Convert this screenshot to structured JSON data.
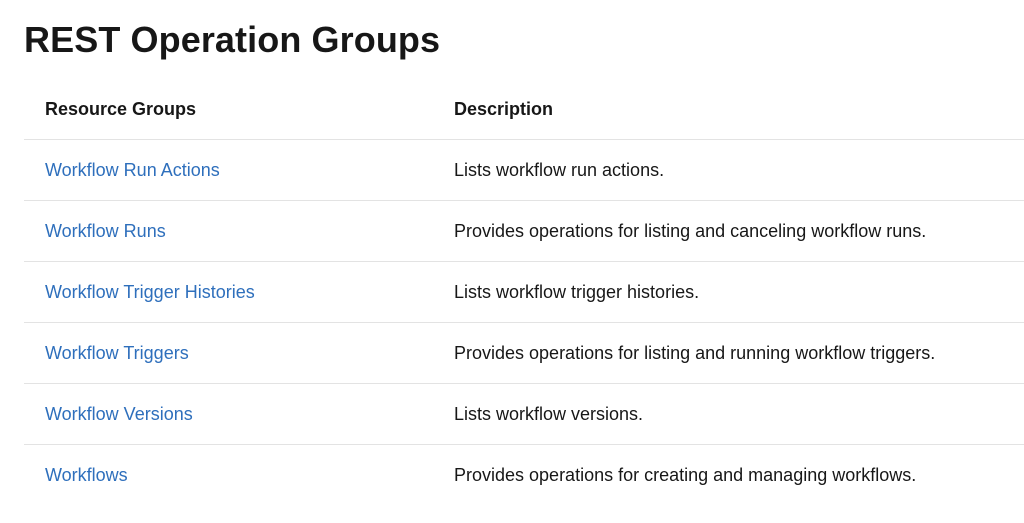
{
  "page": {
    "title": "REST Operation Groups"
  },
  "table": {
    "headers": {
      "resource_groups": "Resource Groups",
      "description": "Description"
    },
    "rows": [
      {
        "name": "Workflow Run Actions",
        "description": "Lists workflow run actions."
      },
      {
        "name": "Workflow Runs",
        "description": "Provides operations for listing and canceling workflow runs."
      },
      {
        "name": "Workflow Trigger Histories",
        "description": "Lists workflow trigger histories."
      },
      {
        "name": "Workflow Triggers",
        "description": "Provides operations for listing and running workflow triggers."
      },
      {
        "name": "Workflow Versions",
        "description": "Lists workflow versions."
      },
      {
        "name": "Workflows",
        "description": "Provides operations for creating and managing workflows."
      }
    ]
  },
  "colors": {
    "link": "#2e6fbc",
    "text": "#171717",
    "divider": "#e3e3e3"
  }
}
